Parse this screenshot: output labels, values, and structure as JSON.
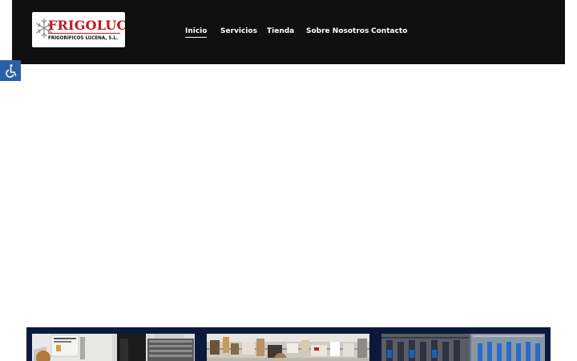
{
  "header": {
    "logo": {
      "title": "FRIGOLUC",
      "subtitle": "FRIGORÍFICOS LUCENA, S.L.",
      "icon": "snowflake-icon",
      "brand_color": "#c3161c"
    },
    "nav": [
      {
        "label": "Inicio",
        "active": true
      },
      {
        "label": "Servicios",
        "active": false
      },
      {
        "label": "Tienda",
        "active": false
      },
      {
        "label": "Sobre Nosotros",
        "active": false
      },
      {
        "label": "Contacto",
        "active": false
      }
    ],
    "background_color": "#0f0f0f"
  },
  "accessibility_button": {
    "icon": "accessibility-icon",
    "color": "#2b5fa8"
  },
  "gallery": {
    "background_color": "#0b1a3a",
    "images": [
      {
        "name": "store-counter-image"
      },
      {
        "name": "store-shelves-image"
      },
      {
        "name": "tools-display-image"
      }
    ]
  }
}
